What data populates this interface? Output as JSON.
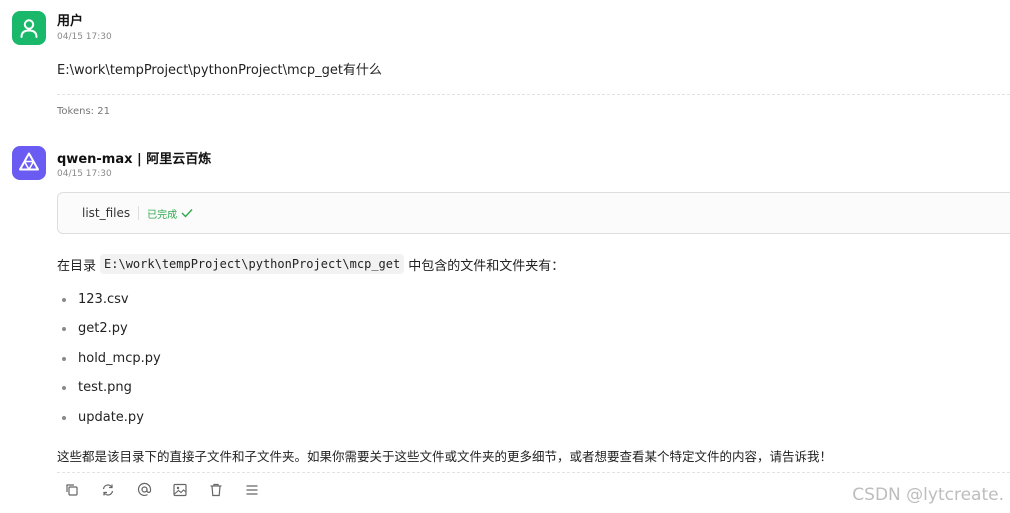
{
  "user_message": {
    "author": "用户",
    "timestamp": "04/15 17:30",
    "text": "E:\\work\\tempProject\\pythonProject\\mcp_get有什么",
    "tokens": "Tokens: 21",
    "avatar_icon": "user-icon",
    "avatar_color": "#19b86a"
  },
  "ai_message": {
    "author": "qwen-max | 阿里云百炼",
    "timestamp": "04/15 17:30",
    "avatar_icon": "qwen-logo-icon",
    "avatar_color": "#6a5cf2",
    "tool_call": {
      "name": "list_files",
      "status": "已完成",
      "status_icon": "check-icon",
      "status_color": "#2fa84f"
    },
    "intro_prefix": "在目录",
    "intro_path": "E:\\work\\tempProject\\pythonProject\\mcp_get",
    "intro_suffix": "中包含的文件和文件夹有：",
    "files": [
      "123.csv",
      "get2.py",
      "hold_mcp.py",
      "test.png",
      "update.py"
    ],
    "summary": "这些都是该目录下的直接子文件和子文件夹。如果你需要关于这些文件或文件夹的更多细节，或者想要查看某个特定文件的内容，请告诉我！",
    "actions": [
      "copy-icon",
      "regenerate-icon",
      "mention-icon",
      "image-icon",
      "delete-icon",
      "menu-icon"
    ]
  },
  "watermark": "CSDN @lytcreate."
}
